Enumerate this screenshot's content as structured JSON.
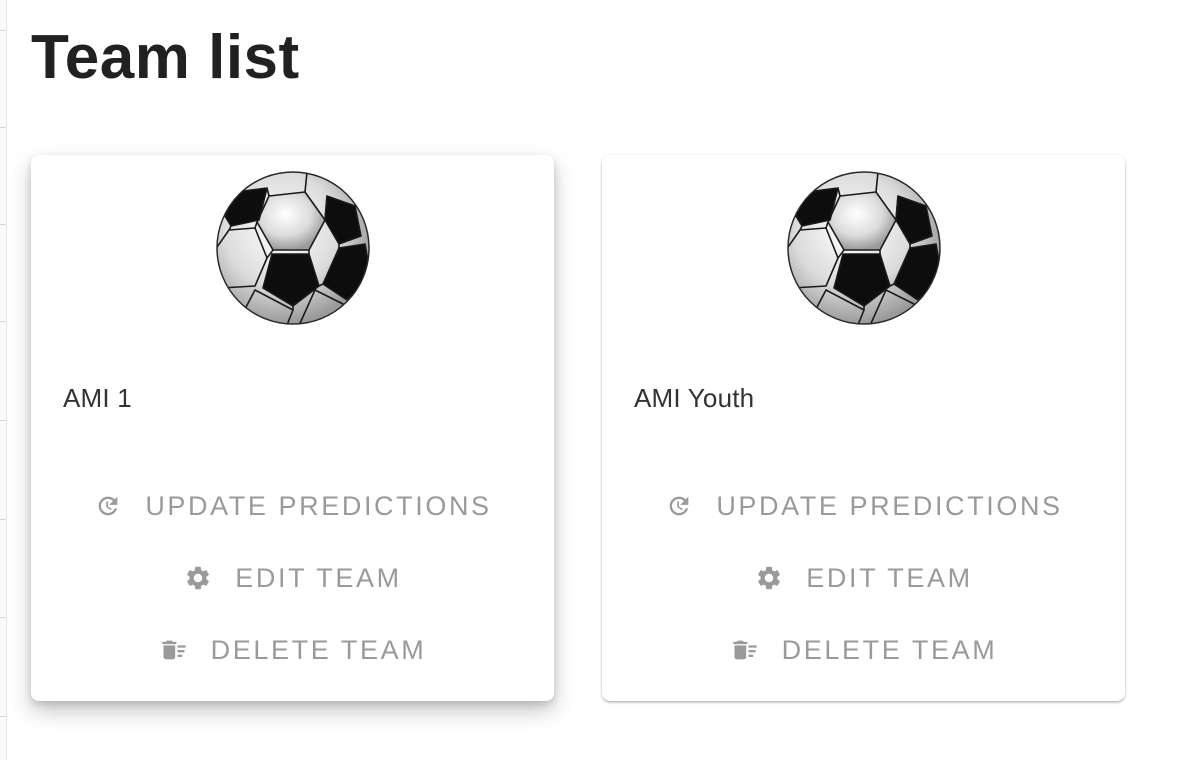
{
  "page": {
    "title": "Team list"
  },
  "colors": {
    "title_text": "#212121",
    "team_name_text": "#333333",
    "action_text": "#9a9a9a",
    "card_background": "#ffffff"
  },
  "teams": [
    {
      "name": "AMI 1",
      "logo_icon": "soccer-ball-icon",
      "actions": [
        {
          "label": "UPDATE PREDICTIONS",
          "icon": "refresh-icon"
        },
        {
          "label": "EDIT TEAM",
          "icon": "gear-icon"
        },
        {
          "label": "DELETE TEAM",
          "icon": "delete-sweep-icon"
        }
      ]
    },
    {
      "name": "AMI Youth",
      "logo_icon": "soccer-ball-icon",
      "actions": [
        {
          "label": "UPDATE PREDICTIONS",
          "icon": "refresh-icon"
        },
        {
          "label": "EDIT TEAM",
          "icon": "gear-icon"
        },
        {
          "label": "DELETE TEAM",
          "icon": "delete-sweep-icon"
        }
      ]
    }
  ]
}
